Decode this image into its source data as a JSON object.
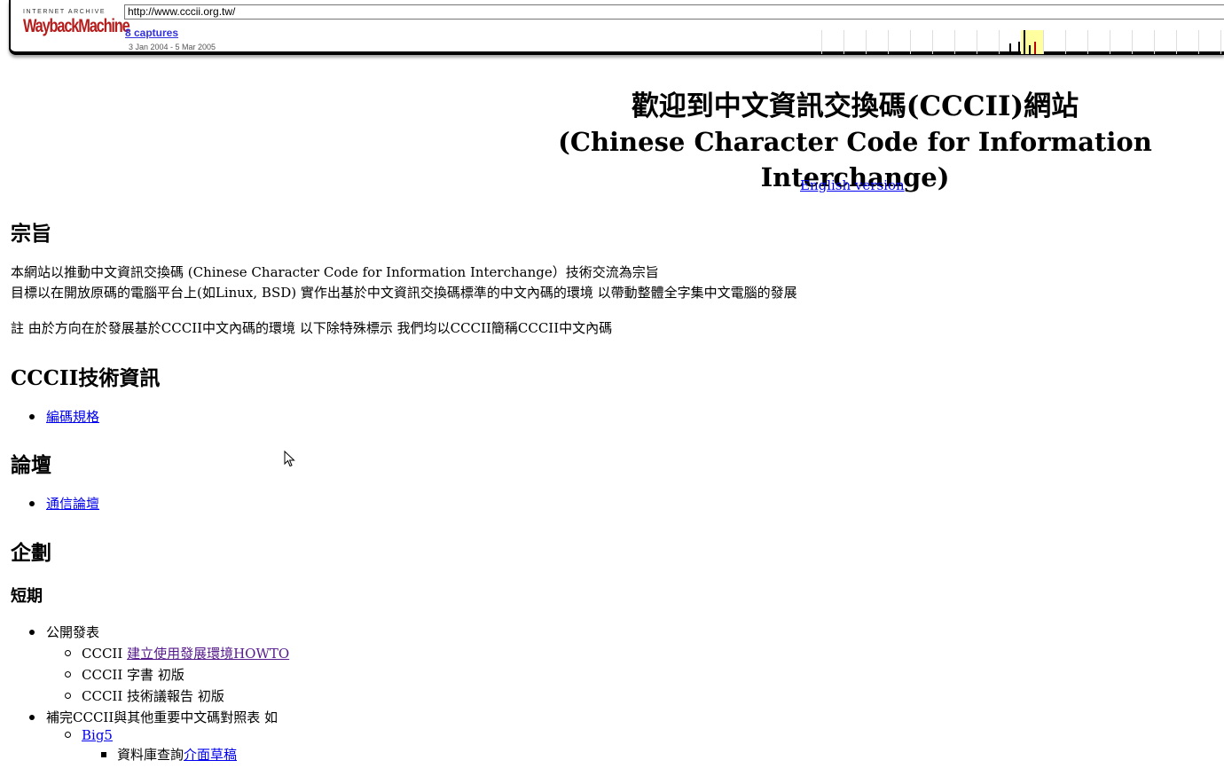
{
  "wayback": {
    "logo_top": "INTERNET ARCHIVE",
    "logo_main": "WaybackMachine",
    "url": "http://www.cccii.org.tw/",
    "captures": "8 captures",
    "date_range": "3 Jan 2004 - 5 Mar 2005"
  },
  "header": {
    "title_zh": "歡迎到中文資訊交換碼(CCCII)網站",
    "title_en": "(Chinese Character Code for Information Interchange)",
    "english_link": "English version"
  },
  "sections": {
    "purpose": {
      "heading": "宗旨",
      "line1": "本網站以推動中文資訊交換碼 (Chinese Character Code for Information Interchange）技術交流為宗旨",
      "line2": "目標以在開放原碼的電腦平台上(如Linux, BSD) 實作出基於中文資訊交換碼標準的中文內碼的環境 以帶動整體全字集中文電腦的發展",
      "note": "註 由於方向在於發展基於CCCII中文內碼的環境 以下除特殊標示 我們均以CCCII簡稱CCCII中文內碼"
    },
    "tech": {
      "heading": "CCCII技術資訊",
      "items": [
        "編碼規格"
      ]
    },
    "forum": {
      "heading": "論壇",
      "items": [
        "通信論壇"
      ]
    },
    "plan": {
      "heading": "企劃",
      "subheading": "短期",
      "item1": "公開發表",
      "sub1_prefix": "CCCII ",
      "sub1_link": "建立使用發展環境HOWTO",
      "sub2": "CCCII 字書 初版",
      "sub3": "CCCII 技術議報告 初版",
      "item2": "補完CCCII與其他重要中文碼對照表 如",
      "sub4_link": "Big5",
      "subsub1_prefix": "資料庫查詢",
      "subsub1_link": "介面草稿"
    }
  }
}
